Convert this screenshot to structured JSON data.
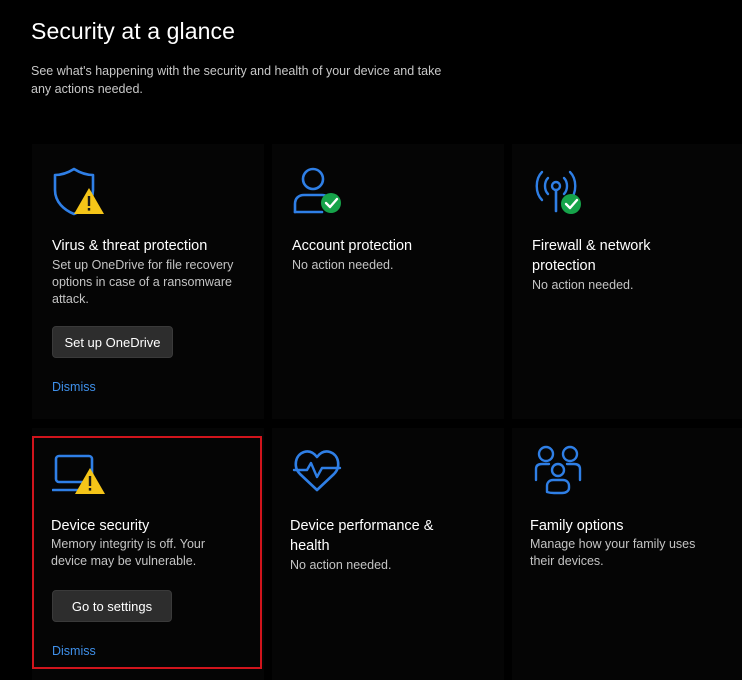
{
  "header": {
    "title": "Security at a glance",
    "subtitle": "See what's happening with the security and health of your device and take any actions needed."
  },
  "cards": {
    "virus": {
      "title": "Virus & threat protection",
      "desc": "Set up OneDrive for file recovery options in case of a ransomware attack.",
      "button": "Set up OneDrive",
      "dismiss": "Dismiss",
      "icon": "shield-warning-icon"
    },
    "account": {
      "title": "Account protection",
      "desc": "No action needed.",
      "icon": "person-check-icon"
    },
    "firewall": {
      "title": "Firewall & network protection",
      "desc": "No action needed.",
      "icon": "wifi-antenna-check-icon"
    },
    "device_security": {
      "title": "Device security",
      "desc": "Memory integrity is off. Your device may be vulnerable.",
      "button": "Go to settings",
      "dismiss": "Dismiss",
      "icon": "laptop-warning-icon"
    },
    "performance": {
      "title": "Device performance & health",
      "desc": "No action needed.",
      "icon": "heart-pulse-icon"
    },
    "family": {
      "title": "Family options",
      "desc": "Manage how your family uses their devices.",
      "icon": "family-icon"
    }
  },
  "colors": {
    "accent": "#2f7fe6",
    "warning": "#f5c518",
    "success": "#16a34a",
    "link": "#3f90ea",
    "highlight": "#d0141c"
  }
}
